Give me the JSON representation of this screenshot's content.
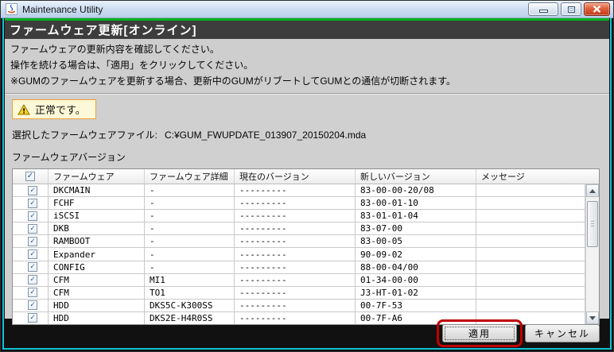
{
  "window": {
    "title": "Maintenance Utility"
  },
  "page": {
    "title": "ファームウェア更新[オンライン]"
  },
  "instructions": {
    "line1": "ファームウェアの更新内容を確認してください。",
    "line2": "操作を続ける場合は、「適用」をクリックしてください。",
    "line3": "※GUMのファームウェアを更新する場合、更新中のGUMがリブートしてGUMとの通信が切断されます。"
  },
  "status": {
    "text": "正常です。"
  },
  "file": {
    "label": "選択したファームウェアファイル:",
    "value": "C:¥GUM_FWUPDATE_013907_20150204.mda"
  },
  "table": {
    "section_label": "ファームウェアバージョン",
    "headers": [
      "ファームウェア",
      "ファームウェア詳細",
      "現在のバージョン",
      "新しいバージョン",
      "メッセージ"
    ],
    "select_all_checked": true,
    "rows": [
      {
        "checked": true,
        "firmware": "DKCMAIN",
        "detail": "-",
        "current": "---------",
        "new_version": "83-00-00-20/08",
        "message": ""
      },
      {
        "checked": true,
        "firmware": "FCHF",
        "detail": "-",
        "current": "---------",
        "new_version": "83-00-01-10",
        "message": ""
      },
      {
        "checked": true,
        "firmware": "iSCSI",
        "detail": "-",
        "current": "---------",
        "new_version": "83-01-01-04",
        "message": ""
      },
      {
        "checked": true,
        "firmware": "DKB",
        "detail": "-",
        "current": "---------",
        "new_version": "83-07-00",
        "message": ""
      },
      {
        "checked": true,
        "firmware": "RAMBOOT",
        "detail": "-",
        "current": "---------",
        "new_version": "83-00-05",
        "message": ""
      },
      {
        "checked": true,
        "firmware": "Expander",
        "detail": "-",
        "current": "---------",
        "new_version": "90-09-02",
        "message": ""
      },
      {
        "checked": true,
        "firmware": "CONFIG",
        "detail": "-",
        "current": "---------",
        "new_version": "88-00-04/00",
        "message": ""
      },
      {
        "checked": true,
        "firmware": "CFM",
        "detail": "MI1",
        "current": "---------",
        "new_version": "01-34-00-00",
        "message": ""
      },
      {
        "checked": true,
        "firmware": "CFM",
        "detail": "TO1",
        "current": "---------",
        "new_version": "J3-HT-01-02",
        "message": ""
      },
      {
        "checked": true,
        "firmware": "HDD",
        "detail": "DKS5C-K300SS",
        "current": "---------",
        "new_version": "00-7F-53",
        "message": ""
      },
      {
        "checked": true,
        "firmware": "HDD",
        "detail": "DKS2E-H4R0SS",
        "current": "---------",
        "new_version": "00-7F-A6",
        "message": ""
      }
    ]
  },
  "buttons": {
    "apply": "適用",
    "cancel": "キャンセル"
  },
  "icons": {
    "check": "✓"
  },
  "colors": {
    "accent_green": "#00b41e",
    "annotation_red": "#c00000",
    "status_border": "#eda13c",
    "status_bg": "#fdf8d7",
    "cyan_border": "#12c2d6",
    "footer_bg": "#111111"
  }
}
